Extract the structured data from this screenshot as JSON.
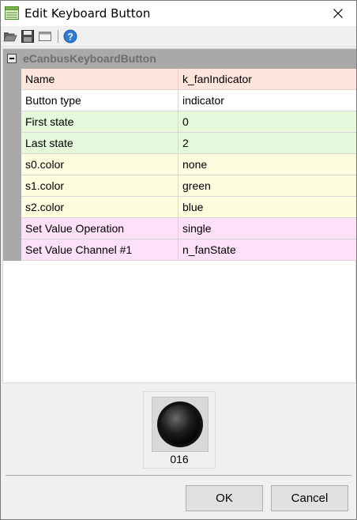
{
  "window": {
    "title": "Edit Keyboard Button"
  },
  "toolbar": {
    "buttons": [
      {
        "icon": "open-folder-icon"
      },
      {
        "icon": "save-disk-icon"
      },
      {
        "icon": "window-icon"
      },
      {
        "icon": "help-icon"
      }
    ]
  },
  "grid": {
    "category": "eCanbusKeyboardButton",
    "properties": [
      {
        "name": "Name",
        "value": "k_fanIndicator",
        "color": "#fde5dc"
      },
      {
        "name": "Button type",
        "value": "indicator",
        "color": "#ffffff"
      },
      {
        "name": "First state",
        "value": "0",
        "color": "#e6f8dc"
      },
      {
        "name": "Last state",
        "value": "2",
        "color": "#e6f8dc"
      },
      {
        "name": "s0.color",
        "value": "none",
        "color": "#fdfde0"
      },
      {
        "name": "s1.color",
        "value": "green",
        "color": "#fdfde0"
      },
      {
        "name": "s2.color",
        "value": "blue",
        "color": "#fdfde0"
      },
      {
        "name": "Set Value Operation",
        "value": "single",
        "color": "#fde1f8"
      },
      {
        "name": "Set Value Channel #1",
        "value": "n_fanState",
        "color": "#fde1f8"
      }
    ]
  },
  "preview": {
    "label": "016"
  },
  "buttons": {
    "ok": "OK",
    "cancel": "Cancel"
  }
}
